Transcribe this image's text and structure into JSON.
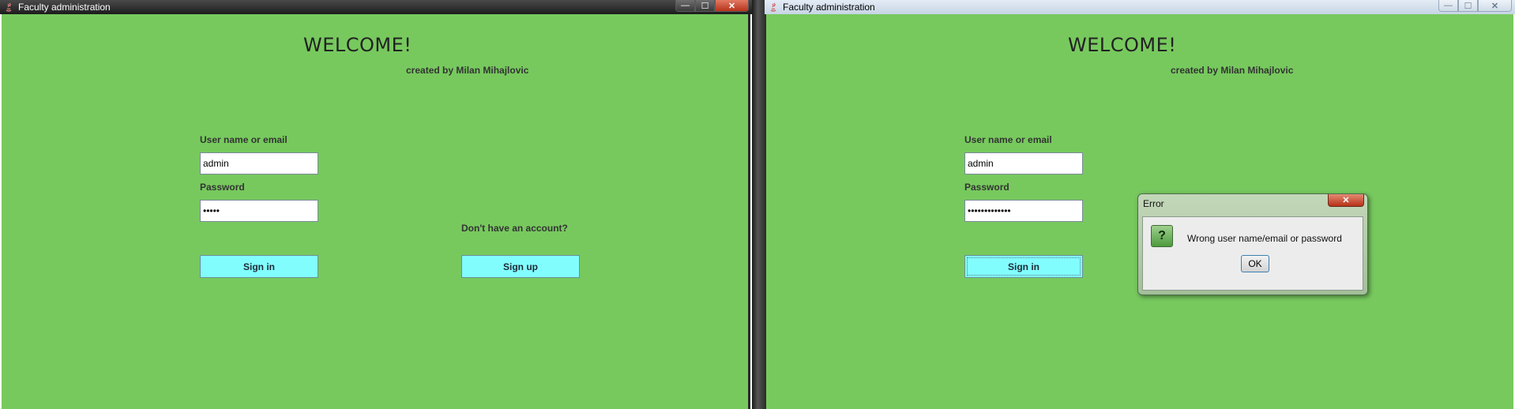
{
  "windows": [
    {
      "title": "Faculty administration",
      "heading": "WELCOME!",
      "credit": "created by Milan Mihajlovic",
      "username_label": "User name or email",
      "username_value": "admin",
      "password_label": "Password",
      "password_value": "•••••",
      "sign_in_label": "Sign in",
      "no_account_text": "Don't have an account?",
      "sign_up_label": "Sign up"
    },
    {
      "title": "Faculty administration",
      "heading": "WELCOME!",
      "credit": "created by Milan Mihajlovic",
      "username_label": "User name or email",
      "username_value": "admin",
      "password_label": "Password",
      "password_value": "•••••••••••••",
      "sign_in_label": "Sign in"
    }
  ],
  "dialog": {
    "title": "Error",
    "close_glyph": "✕",
    "icon_glyph": "?",
    "message": "Wrong user name/email or password",
    "ok_label": "OK"
  },
  "icons": {
    "min": "—",
    "max": "☐",
    "close": "✕"
  },
  "colors": {
    "background": "#77c95e",
    "button": "#82fdfe"
  }
}
